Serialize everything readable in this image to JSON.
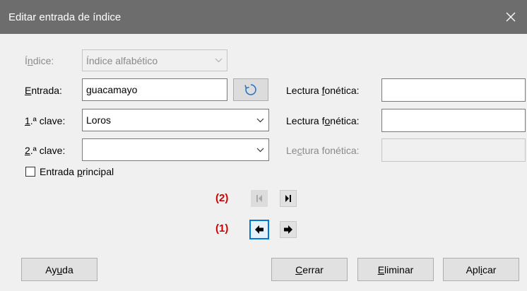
{
  "window": {
    "title": "Editar entrada de índice"
  },
  "icons": {
    "close": "close-icon",
    "refresh": "refresh-icon",
    "dropdown": "chevron-down-icon",
    "first": "first-entry-icon",
    "last": "last-entry-icon",
    "previous": "arrow-left-icon",
    "next": "arrow-right-icon"
  },
  "form": {
    "index": {
      "label_pre": "Í",
      "label_ul": "n",
      "label_post": "dice:",
      "value": "Índice alfabético"
    },
    "entry": {
      "label_pre": "",
      "label_ul": "E",
      "label_post": "ntrada:",
      "value": "guacamayo"
    },
    "key1": {
      "label_pre": "",
      "label_ul": "1",
      "label_post": ".ª clave:",
      "value": "Loros"
    },
    "key2": {
      "label_pre": "",
      "label_ul": "2",
      "label_post": ".ª clave:",
      "value": ""
    },
    "phonetic1": {
      "label_pre": "Lectura ",
      "label_ul": "f",
      "label_post": "onética:",
      "value": ""
    },
    "phonetic2": {
      "label_pre": "Lectura f",
      "label_ul": "o",
      "label_post": "nética:",
      "value": ""
    },
    "phonetic3": {
      "label_pre": "Le",
      "label_ul": "c",
      "label_post": "tura fonética:",
      "value": ""
    },
    "main_entry": {
      "label_pre": "Entrada ",
      "label_ul": "p",
      "label_post": "rincipal",
      "checked": false
    }
  },
  "annotations": {
    "marker2": "(2)",
    "marker1": "(1)"
  },
  "buttons": {
    "help": {
      "pre": "Ay",
      "ul": "u",
      "post": "da"
    },
    "close": {
      "pre": "",
      "ul": "C",
      "post": "errar"
    },
    "delete": {
      "pre": "",
      "ul": "E",
      "post": "liminar"
    },
    "apply": {
      "pre": "Apl",
      "ul": "i",
      "post": "car"
    }
  },
  "colors": {
    "titlebar": "#6d6d6d",
    "marker": "#d00000",
    "focus": "#0078d7",
    "refresh_icon": "#1e6fc9"
  }
}
